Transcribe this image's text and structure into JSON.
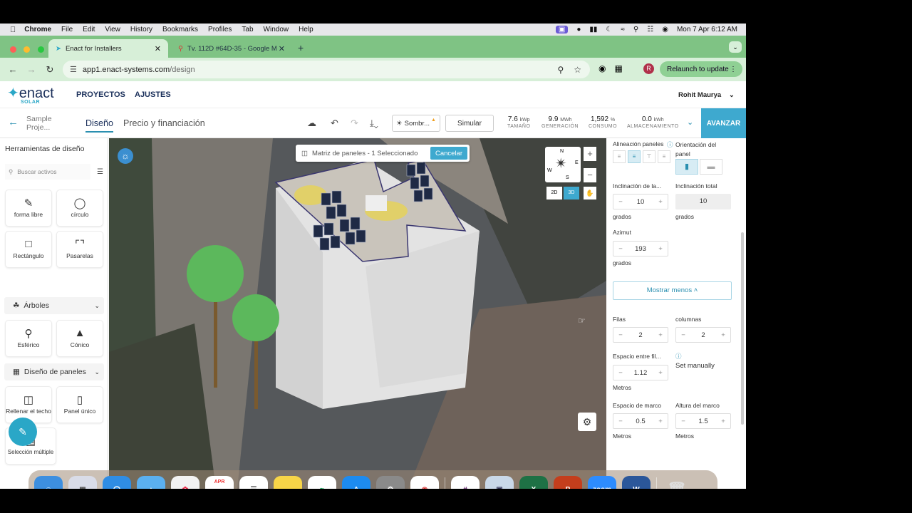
{
  "menubar": {
    "app": "Chrome",
    "items": [
      "File",
      "Edit",
      "View",
      "History",
      "Bookmarks",
      "Profiles",
      "Tab",
      "Window",
      "Help"
    ],
    "datetime": "Mon 7 Apr  6:12 AM"
  },
  "tabs": [
    {
      "title": "Enact for Installers"
    },
    {
      "title": "Tv. 112D #64D-35 - Google M"
    }
  ],
  "address": {
    "url_host": "app1.enact-systems.com",
    "url_path": "/design",
    "avatar_letter": "R",
    "relaunch_label": "Relaunch to update"
  },
  "app": {
    "logo": "enact",
    "logo_sub": "SOLAR",
    "nav": [
      "PROYECTOS",
      "AJUSTES"
    ],
    "user": "Rohit Maurya"
  },
  "toolbar": {
    "project": "Sample Proje...",
    "tab_design": "Diseño",
    "tab_price": "Precio y financiación",
    "sombra_label": "Sombr...",
    "simular_label": "Simular",
    "avanzar_label": "AVANZAR",
    "stats": [
      {
        "value": "7.6",
        "unit": "kWp",
        "label": "TAMAÑO"
      },
      {
        "value": "9.9",
        "unit": "MWh",
        "label": "GENERACIÓN"
      },
      {
        "value": "1,592",
        "unit": "%",
        "label": "CONSUMO"
      },
      {
        "value": "0.0",
        "unit": "kWh",
        "label": "ALMACENAMIENTO"
      }
    ]
  },
  "left_panel": {
    "title": "Herramientas de diseño",
    "search_placeholder": "Buscar activos",
    "tools_top": [
      {
        "label": "forma libre",
        "icon": "freeform-icon"
      },
      {
        "label": "círculo",
        "icon": "circle-icon"
      },
      {
        "label": "Rectángulo",
        "icon": "rectangle-icon"
      },
      {
        "label": "Pasarelas",
        "icon": "walkway-icon"
      }
    ],
    "section_trees": "Árboles",
    "tools_trees": [
      {
        "label": "Esférico",
        "icon": "spherical-tree-icon"
      },
      {
        "label": "Cónico",
        "icon": "conical-tree-icon"
      }
    ],
    "section_panels": "Diseño de paneles",
    "tools_panels": [
      {
        "label": "Rellenar el techo",
        "icon": "fill-roof-icon"
      },
      {
        "label": "Panel único",
        "icon": "single-panel-icon"
      },
      {
        "label": "Selección múltiple",
        "icon": "multi-select-icon"
      }
    ]
  },
  "map": {
    "matrix_text": "Matriz de paneles - 1 Seleccionado",
    "cancel_label": "Cancelar",
    "view_2d": "2D",
    "view_3d": "3D",
    "compass": {
      "n": "N",
      "s": "S",
      "e": "E",
      "w": "W"
    }
  },
  "right_panel": {
    "alignment_label": "Alineación paneles",
    "orientation_label": "Orientación del panel",
    "tilt_label": "Inclinación de la...",
    "tilt_value": "10",
    "tilt_unit": "grados",
    "total_tilt_label": "Inclinación total",
    "total_tilt_value": "10",
    "total_tilt_unit": "grados",
    "azimuth_label": "Azimut",
    "azimuth_value": "193",
    "azimuth_unit": "grados",
    "show_less": "Mostrar menos",
    "rows_label": "Filas",
    "rows_value": "2",
    "cols_label": "columnas",
    "cols_value": "2",
    "row_spacing_label": "Espacio entre fil...",
    "row_spacing_value": "1.12",
    "row_spacing_unit": "Metros",
    "set_manually": "Set manually",
    "frame_spacing_label": "Espacio de marco",
    "frame_spacing_value": "0.5",
    "frame_spacing_unit": "Metros",
    "frame_height_label": "Altura del marco",
    "frame_height_value": "1.5",
    "frame_height_unit": "Metros"
  },
  "dock": {
    "calendar_month": "APR",
    "calendar_day": "7",
    "zoom_label": "zoom"
  }
}
